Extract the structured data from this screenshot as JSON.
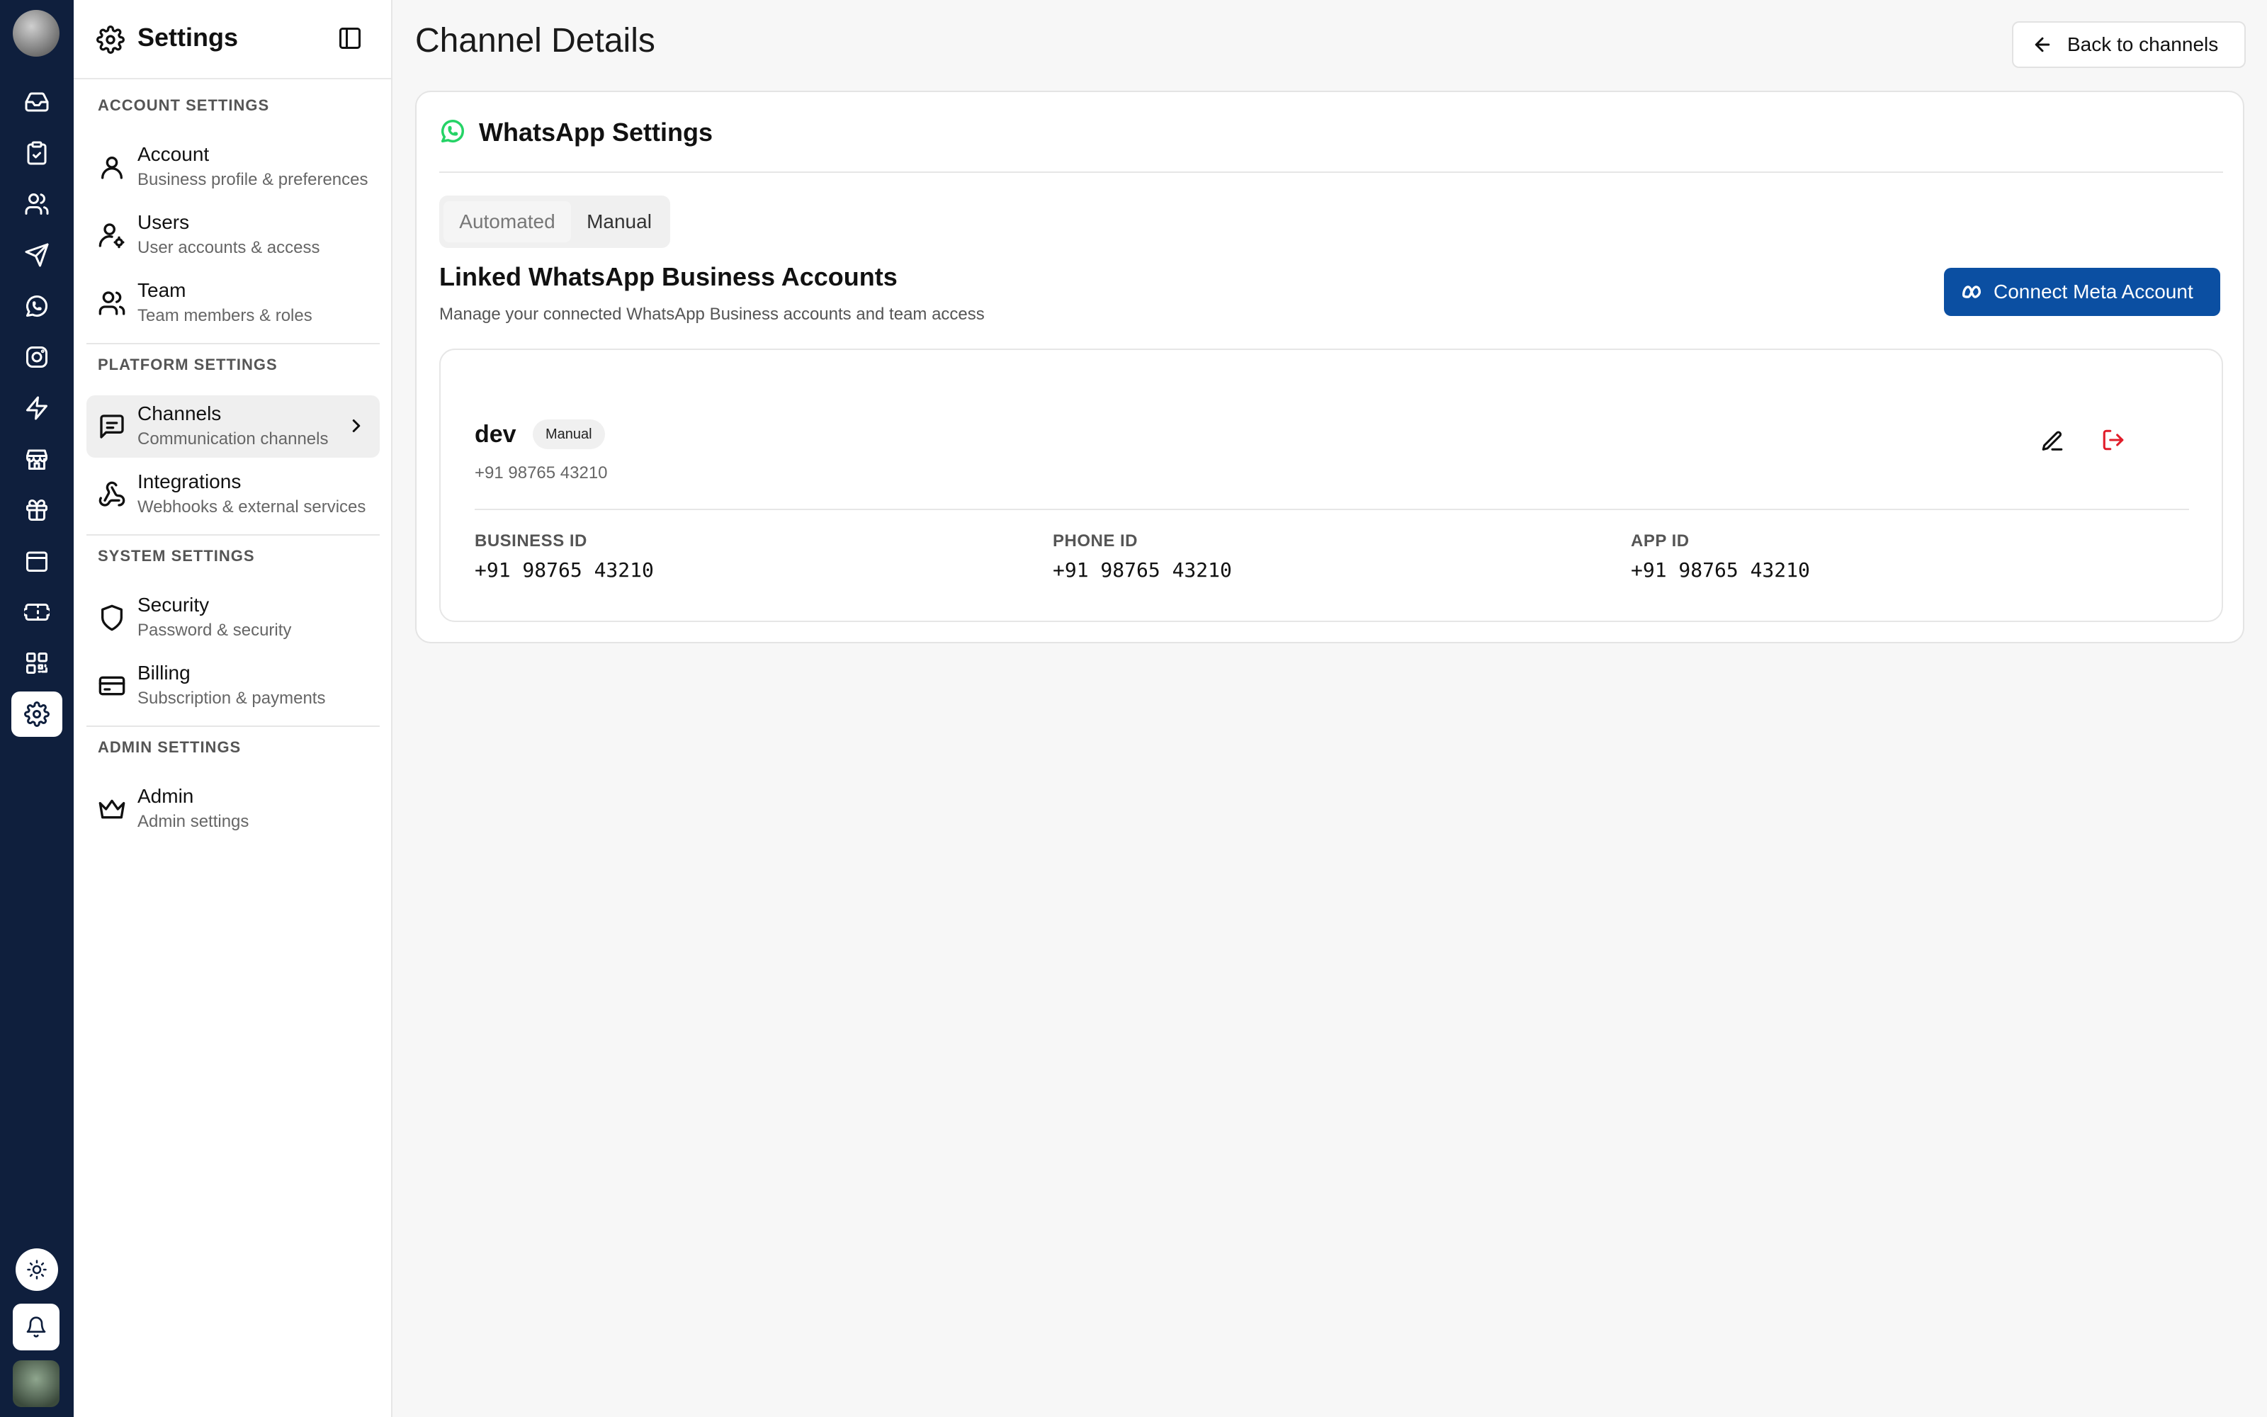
{
  "sidebar": {
    "title": "Settings",
    "sections": [
      {
        "label": "ACCOUNT SETTINGS"
      },
      {
        "label": "PLATFORM SETTINGS"
      },
      {
        "label": "SYSTEM SETTINGS"
      },
      {
        "label": "ADMIN SETTINGS"
      }
    ],
    "items": [
      {
        "title": "Account",
        "subtitle": "Business profile & preferences",
        "icon": "user-icon"
      },
      {
        "title": "Users",
        "subtitle": "User accounts & access",
        "icon": "user-cog-icon"
      },
      {
        "title": "Team",
        "subtitle": "Team members & roles",
        "icon": "users-icon"
      },
      {
        "title": "Channels",
        "subtitle": "Communication channels",
        "icon": "message-square-icon",
        "active": true
      },
      {
        "title": "Integrations",
        "subtitle": "Webhooks & external services",
        "icon": "webhook-icon"
      },
      {
        "title": "Security",
        "subtitle": "Password & security",
        "icon": "shield-icon"
      },
      {
        "title": "Billing",
        "subtitle": "Subscription & payments",
        "icon": "credit-card-icon"
      },
      {
        "title": "Admin",
        "subtitle": "Admin settings",
        "icon": "crown-icon"
      }
    ]
  },
  "rail": {
    "icons": [
      "inbox-icon",
      "clipboard-icon",
      "users-icon",
      "send-icon",
      "whatsapp-icon",
      "instagram-icon",
      "zap-icon",
      "store-icon",
      "gift-icon",
      "calendar-icon",
      "ticket-icon",
      "qr-code-icon",
      "settings-icon",
      "sun-icon",
      "bell-icon"
    ],
    "active": "settings-icon",
    "colors": {
      "background": "#0f1f3d"
    }
  },
  "main": {
    "title": "Channel Details",
    "back_label": "Back to channels"
  },
  "card": {
    "title": "WhatsApp Settings",
    "tabs": [
      "Automated",
      "Manual"
    ],
    "selected_tab": "Manual",
    "section_title": "Linked WhatsApp Business Accounts",
    "section_desc": "Manage your connected WhatsApp Business accounts and team access",
    "connect_label": "Connect Meta Account",
    "colors": {
      "accent": "#0b4fa2",
      "whatsapp": "#25d366",
      "danger": "#e11d2a"
    }
  },
  "account": {
    "name": "dev",
    "badge": "Manual",
    "phone": "+91 98765 43210",
    "fields": [
      {
        "label": "BUSINESS ID",
        "value": "+91 98765 43210"
      },
      {
        "label": "PHONE ID",
        "value": "+91 98765 43210"
      },
      {
        "label": "APP ID",
        "value": "+91 98765 43210"
      }
    ]
  }
}
